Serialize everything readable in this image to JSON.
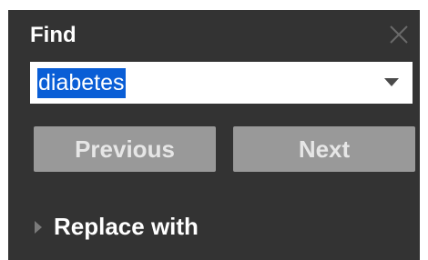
{
  "dialog": {
    "title": "Find",
    "close_icon": "close-icon",
    "search": {
      "value": "diabetes",
      "selection_color": "#0a5ed6",
      "dropdown_icon": "caret-down-icon"
    },
    "buttons": {
      "previous_label": "Previous",
      "next_label": "Next"
    },
    "replace": {
      "label": "Replace with",
      "expand_icon": "caret-right-icon",
      "expanded": false
    }
  },
  "colors": {
    "panel_background": "#333333",
    "button_background": "#999999",
    "button_text": "#e6e6e6"
  }
}
